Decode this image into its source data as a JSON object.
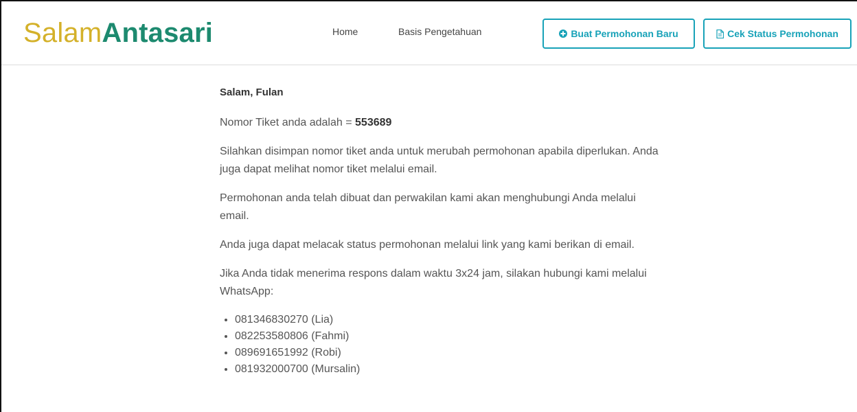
{
  "brand": {
    "part1": "Salam",
    "part2": "Antasari",
    "color_part1": "#d4b12a",
    "color_part2": "#1d8a6f"
  },
  "nav": {
    "home": "Home",
    "knowledge_base": "Basis Pengetahuan"
  },
  "buttons": {
    "new_request": "Buat Permohonan Baru",
    "new_request_icon": "plus-circle-icon",
    "check_status": "Cek Status Permohonan",
    "check_status_icon": "document-icon",
    "accent": "#17a2b8"
  },
  "content": {
    "greeting": "Salam, Fulan",
    "ticket_prefix": "Nomor Tiket anda adalah = ",
    "ticket_number": "553689",
    "paragraph1": "Silahkan disimpan nomor tiket anda untuk merubah permohonan apabila diperlukan. Anda juga dapat melihat nomor tiket melalui email.",
    "paragraph2": "Permohonan anda telah dibuat dan perwakilan kami akan menghubungi Anda melalui email.",
    "paragraph3": "Anda juga dapat melacak status permohonan melalui link yang kami berikan di email.",
    "paragraph4": "Jika Anda tidak menerima respons dalam waktu 3x24 jam, silakan hubungi kami melalui WhatsApp:",
    "contacts": [
      "081346830270 (Lia)",
      "082253580806 (Fahmi)",
      "089691651992 (Robi)",
      "081932000700 (Mursalin)"
    ]
  }
}
